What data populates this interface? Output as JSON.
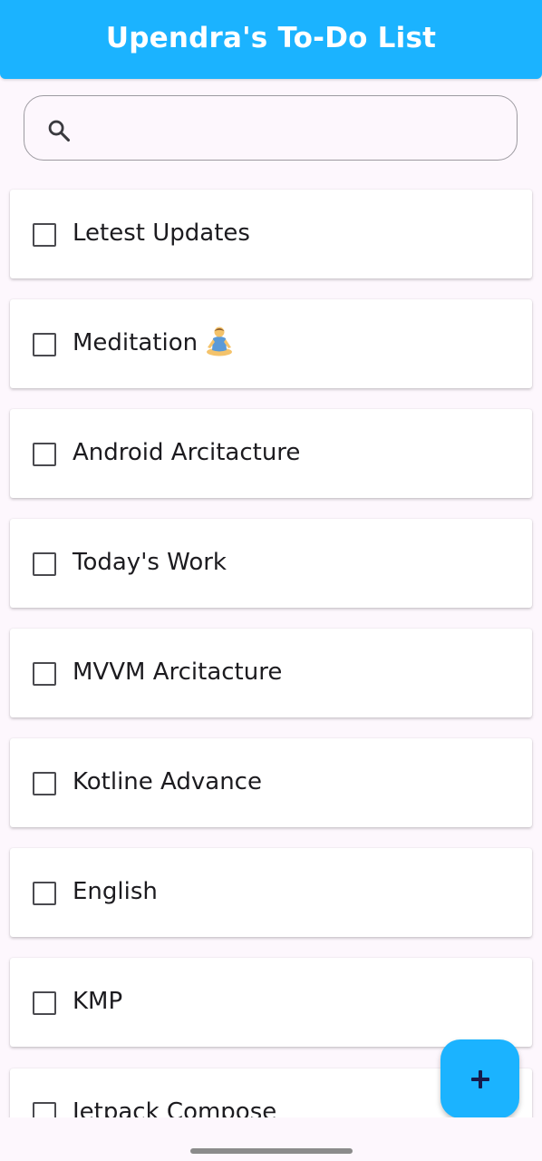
{
  "app_bar": {
    "title": "Upendra's To-Do List",
    "background_color": "#1bb3ff"
  },
  "search": {
    "value": "",
    "placeholder": "",
    "icon": "search-icon"
  },
  "tasks": [
    {
      "label": "Letest Updates",
      "checked": false
    },
    {
      "label": "Meditation",
      "checked": false,
      "icon": "person-in-lotus-position-icon"
    },
    {
      "label": "Android Arcitacture",
      "checked": false
    },
    {
      "label": "Today's Work",
      "checked": false
    },
    {
      "label": "MVVM Arcitacture",
      "checked": false
    },
    {
      "label": "Kotline Advance",
      "checked": false
    },
    {
      "label": "English",
      "checked": false
    },
    {
      "label": "KMP",
      "checked": false
    },
    {
      "label": "Jetpack Compose",
      "checked": false
    }
  ],
  "fab": {
    "icon": "plus-icon",
    "background_color": "#1bb3ff"
  }
}
